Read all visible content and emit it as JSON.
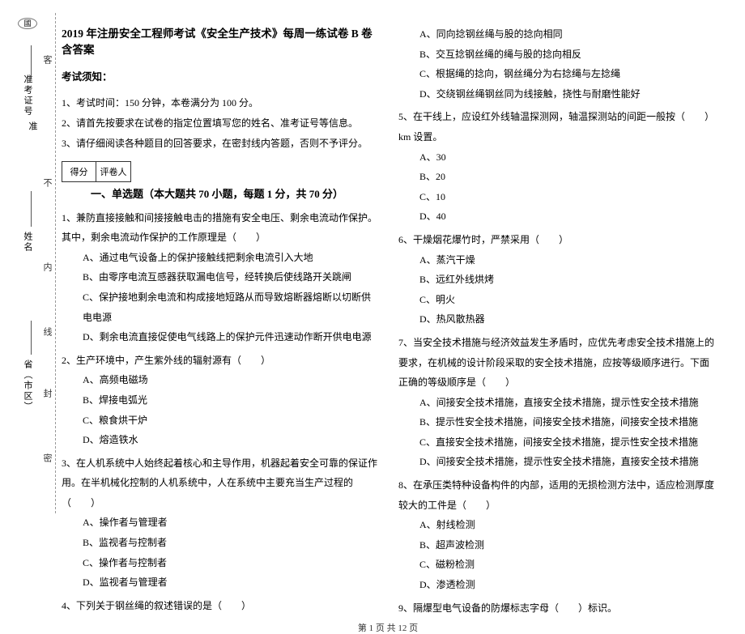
{
  "binding": {
    "oval_top": "國",
    "vlabels": {
      "l1": "客",
      "l2": "不",
      "l3": "内",
      "l4": "线",
      "l5": "封",
      "l6": "密"
    },
    "form": {
      "field1": "准考证号",
      "field1_value": "准",
      "field2": "姓名",
      "field3": "省（市区）"
    }
  },
  "title": "2019 年注册安全工程师考试《安全生产技术》每周一练试卷 B 卷 含答案",
  "notice_head": "考试须知：",
  "notices": [
    "1、考试时间：150 分钟，本卷满分为 100 分。",
    "2、请首先按要求在试卷的指定位置填写您的姓名、准考证号等信息。",
    "3、请仔细阅读各种题目的回答要求，在密封线内答题，否则不予评分。"
  ],
  "scorebox": {
    "c1": "得分",
    "c2": "评卷人"
  },
  "section1_title": "一、单选题（本大题共 70 小题，每题 1 分，共 70 分）",
  "left": {
    "q1": "1、兼防直接接触和间接接触电击的措施有安全电压、剩余电流动作保护。其中，剩余电流动作保护的工作原理是（　　）",
    "q1o": [
      "A、通过电气设备上的保护接触线把剩余电流引入大地",
      "B、由零序电流互感器获取漏电信号，经转换后使线路开关跳闸",
      "C、保护接地剩余电流和构成接地短路从而导致熔断器熔断以切断供电电源",
      "D、剩余电流直接促使电气线路上的保护元件迅速动作断开供电电源"
    ],
    "q2": "2、生产环境中，产生紫外线的辐射源有（　　）",
    "q2o": [
      "A、高频电磁场",
      "B、焊接电弧光",
      "C、粮食烘干炉",
      "D、熔造铁水"
    ],
    "q3": "3、在人机系统中人始终起着核心和主导作用，机器起着安全可靠的保证作用。在半机械化控制的人机系统中，人在系统中主要充当生产过程的（　　）",
    "q3o": [
      "A、操作者与管理者",
      "B、监视者与控制者",
      "C、操作者与控制者",
      "D、监视者与管理者"
    ],
    "q4": "4、下列关于钢丝绳的叙述错误的是（　　）"
  },
  "right": {
    "q4o": [
      "A、同向捻钢丝绳与股的捻向相同",
      "B、交互捻钢丝绳的绳与股的捻向相反",
      "C、根据绳的捻向，钢丝绳分为右捻绳与左捻绳",
      "D、交绕钢丝绳钢丝同为线接触，挠性与耐磨性能好"
    ],
    "q5": "5、在干线上，应设红外线轴温探测网，轴温探测站的间距一般按（　　）km 设置。",
    "q5o": [
      "A、30",
      "B、20",
      "C、10",
      "D、40"
    ],
    "q6": "6、干燥烟花爆竹时，严禁采用（　　）",
    "q6o": [
      "A、蒸汽干燥",
      "B、远红外线烘烤",
      "C、明火",
      "D、热风散热器"
    ],
    "q7": "7、当安全技术措施与经济效益发生矛盾时，应优先考虑安全技术措施上的要求，在机械的设计阶段采取的安全技术措施，应按等级顺序进行。下面正确的等级顺序是（　　）",
    "q7o": [
      "A、间接安全技术措施，直接安全技术措施，提示性安全技术措施",
      "B、提示性安全技术措施，间接安全技术措施，间接安全技术措施",
      "C、直接安全技术措施，间接安全技术措施，提示性安全技术措施",
      "D、间接安全技术措施，提示性安全技术措施，直接安全技术措施"
    ],
    "q8": "8、在承压类特种设备构件的内部，适用的无损检测方法中，适应检测厚度较大的工件是（　　）",
    "q8o": [
      "A、射线检测",
      "B、超声波检测",
      "C、磁粉检测",
      "D、渗透检测"
    ],
    "q9": "9、隔爆型电气设备的防爆标志字母（　　）标识。"
  },
  "footer": "第 1 页 共 12 页"
}
